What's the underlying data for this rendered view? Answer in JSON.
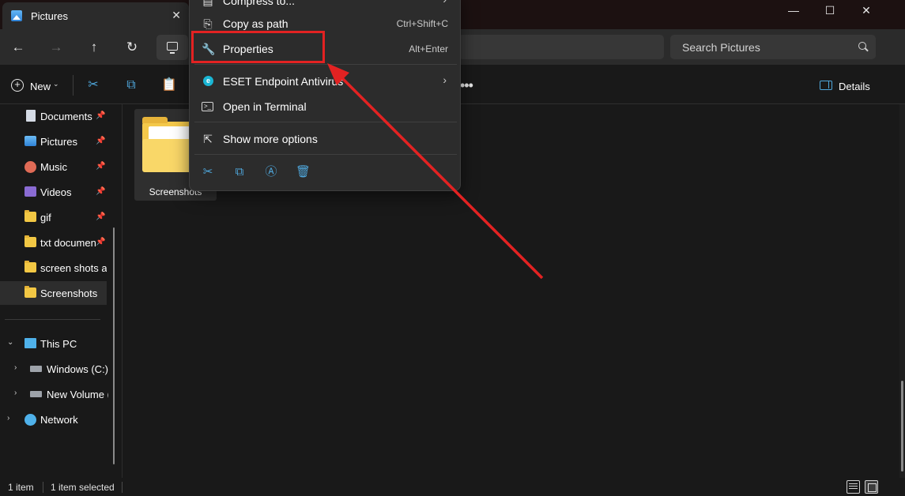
{
  "window": {
    "tab_title": "Pictures",
    "tab_close": "✕",
    "minimize": "—",
    "maximize": "☐",
    "close": "✕"
  },
  "nav": {
    "back": "←",
    "forward": "→",
    "up": "↑",
    "refresh": "↻"
  },
  "search": {
    "placeholder": "Search Pictures"
  },
  "toolbar": {
    "new_label": "New",
    "more": "•••",
    "details_label": "Details"
  },
  "sidebar": {
    "quick_access": [
      {
        "label": "Documents",
        "icon": "document-icon",
        "pinned": true
      },
      {
        "label": "Pictures",
        "icon": "pictures-icon",
        "pinned": true
      },
      {
        "label": "Music",
        "icon": "music-icon",
        "pinned": true
      },
      {
        "label": "Videos",
        "icon": "videos-icon",
        "pinned": true
      },
      {
        "label": "gif",
        "icon": "folder-icon",
        "pinned": true
      },
      {
        "label": "txt documen",
        "icon": "folder-icon",
        "pinned": true
      },
      {
        "label": "screen shots anc",
        "icon": "folder-icon",
        "pinned": false
      },
      {
        "label": "Screenshots",
        "icon": "folder-icon",
        "pinned": false,
        "selected": true
      }
    ],
    "this_pc": "This PC",
    "drives": [
      {
        "label": "Windows (C:)"
      },
      {
        "label": "New Volume (I"
      }
    ],
    "network": "Network"
  },
  "content": {
    "items": [
      {
        "name": "Screenshots",
        "type": "folder"
      }
    ]
  },
  "status": {
    "count": "1 item",
    "selected": "1 item selected"
  },
  "context_menu": {
    "items": [
      {
        "label": "Compress to...",
        "icon": "zip-icon",
        "shortcut": ""
      },
      {
        "label": "Copy as path",
        "icon": "copy-path-icon",
        "shortcut": "Ctrl+Shift+C"
      },
      {
        "label": "Properties",
        "icon": "wrench-icon",
        "shortcut": "Alt+Enter",
        "highlighted": true
      },
      {
        "label": "ESET Endpoint Antivirus",
        "icon": "eset-icon",
        "submenu": true
      },
      {
        "label": "Open in Terminal",
        "icon": "terminal-icon"
      },
      {
        "label": "Show more options",
        "icon": "more-options-icon"
      }
    ],
    "actions": [
      "cut-icon",
      "copy-icon",
      "rename-icon",
      "delete-icon"
    ]
  },
  "annotation": {
    "highlight_color": "#e32222",
    "arrow_color": "#e32222"
  }
}
